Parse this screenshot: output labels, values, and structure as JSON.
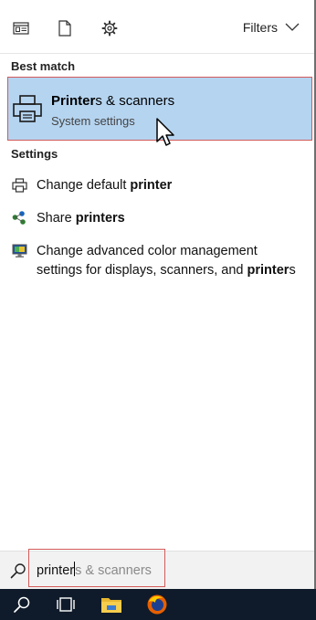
{
  "filterbar": {
    "icons": [
      "apps-icon",
      "document-icon",
      "gear-icon"
    ],
    "filters_label": "Filters"
  },
  "best_match": {
    "header": "Best match",
    "title_bold": "Printer",
    "title_rest": "s & scanners",
    "subtitle": "System settings"
  },
  "settings": {
    "header": "Settings",
    "items": [
      {
        "icon": "printer-icon",
        "text": "Change default ",
        "bold": "printer",
        "after": ""
      },
      {
        "icon": "share-icon",
        "text": "Share ",
        "bold": "printers",
        "after": ""
      },
      {
        "icon": "monitor-icon",
        "text": "Change advanced color management settings for displays, scanners, and ",
        "bold": "printer",
        "after": "s"
      }
    ]
  },
  "search": {
    "typed": "printer",
    "suggestion": "s & scanners"
  },
  "colors": {
    "selection": "#b5d4f0",
    "highlight_border": "#d25a5a",
    "taskbar": "#0f1b2a"
  },
  "taskbar": {
    "items": [
      "search-icon",
      "task-view-icon",
      "file-explorer-icon",
      "firefox-icon"
    ]
  }
}
